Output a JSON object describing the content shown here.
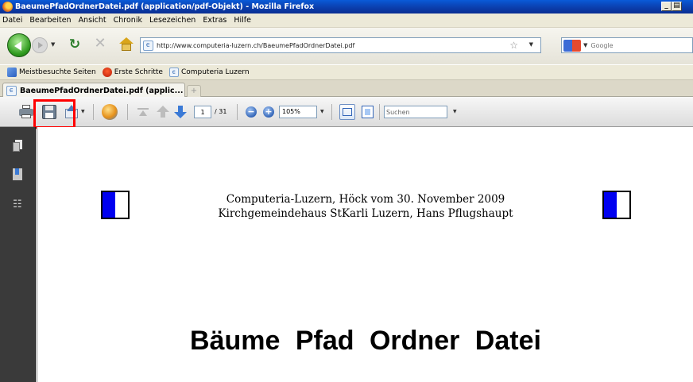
{
  "window": {
    "title": "BaeumePfadOrdnerDatei.pdf (application/pdf-Objekt) - Mozilla Firefox",
    "minimize_glyph": "_",
    "maximize_glyph": "̅□"
  },
  "menu": [
    "Datei",
    "Bearbeiten",
    "Ansicht",
    "Chronik",
    "Lesezeichen",
    "Extras",
    "Hilfe"
  ],
  "navigation": {
    "url": "http://www.computeria-luzern.ch/BaeumePfadOrdnerDatei.pdf",
    "search_placeholder": "Google"
  },
  "bookmarks": [
    {
      "label": "Meistbesuchte Seiten",
      "icon": "most-visited-icon"
    },
    {
      "label": "Erste Schritte",
      "icon": "first-steps-icon"
    },
    {
      "label": "Computeria Luzern",
      "icon": "site-favicon"
    }
  ],
  "tabs": [
    {
      "label": "BaeumePfadOrdnerDatei.pdf (applic...",
      "active": true
    }
  ],
  "pdf_toolbar": {
    "current_page": "1",
    "total_pages": "/ 31",
    "zoom": "105%",
    "find_placeholder": "Suchen",
    "highlight_color": "#ff0000"
  },
  "document": {
    "header_line1": "Computeria-Luzern, Höck vom 30. November 2009",
    "header_line2": "Kirchgemeindehaus StKarli Luzern, Hans Pflugshaupt",
    "heading": "Bäume Pfad Ordner Datei",
    "logo_color": "#0000f0"
  }
}
